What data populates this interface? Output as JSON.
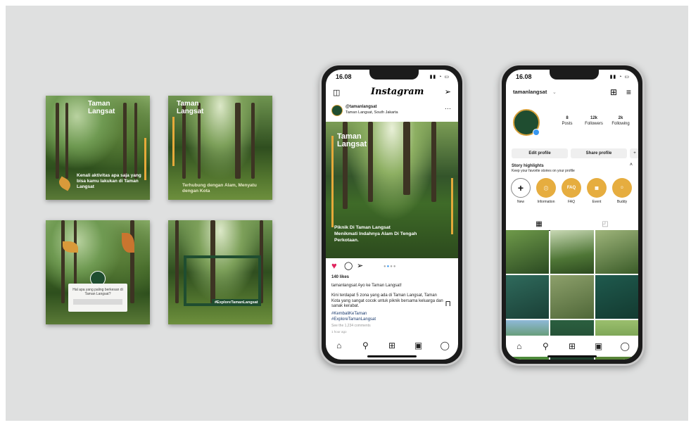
{
  "posts": {
    "p1": {
      "title": "Taman\nLangsat",
      "caption": "Kenali aktivitas apa saja yang bisa kamu lakukan di Taman Langsat"
    },
    "p2": {
      "title": "Taman\nLangsat",
      "caption": "Terhubung dengan Alam, Menyatu dengan Kota"
    },
    "p3": {
      "question": "Hal apa yang paling berkesan di Taman Langsat?"
    },
    "p4": {
      "hashtag": "#ExploreTamanLangsat"
    }
  },
  "phone1": {
    "time": "16.08",
    "app_title": "Instagram",
    "account": "@tamanlangsat",
    "location": "Taman Langsat, South Jakarta",
    "image_title": "Taman\nLangsat",
    "image_caption": "Piknik Di Taman Langsat\nMenikmati Indahnya Alam Di Tengah\nPerkotaan.",
    "likes": "140 likes",
    "caption_line": "tamanlangsat Ayo ke Taman Langsat!",
    "body": "Kini terdapat 5 zona yang ada di Taman Langsat, Taman Kota yang sangat cocok untuk piknik bersama keluarga dan sanak kerabat.",
    "hashtags": "#KembaliKeTaman\n#ExploreTamanLangsat",
    "comments": "See the 1,234 comments",
    "ago": "1 hour ago"
  },
  "phone2": {
    "time": "16.08",
    "username": "tamanlangsat",
    "posts_n": "8",
    "posts_l": "Posts",
    "followers_n": "12k",
    "followers_l": "Followers",
    "following_n": "2k",
    "following_l": "Following",
    "edit": "Edit profile",
    "share": "Share profile",
    "hl_title": "Story highlights",
    "hl_sub": "Keep your favorite stories on your profile",
    "highlights": [
      {
        "label": "New"
      },
      {
        "label": "Information"
      },
      {
        "label": "FAQ",
        "inner": "FAQ"
      },
      {
        "label": "Event"
      },
      {
        "label": "Buddy"
      }
    ]
  }
}
